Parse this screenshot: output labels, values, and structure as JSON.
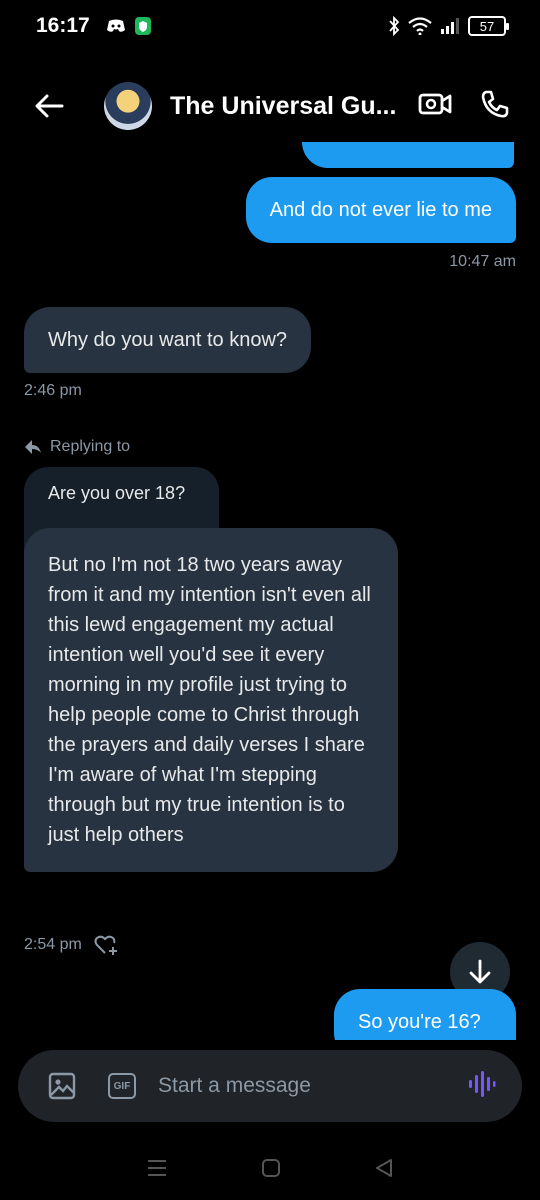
{
  "status_bar": {
    "time": "16:17",
    "battery": "57"
  },
  "header": {
    "title": "The Universal Gu..."
  },
  "messages": {
    "sent1_partial": "",
    "sent2": "And do not ever lie to me",
    "sent2_time": "10:47 am",
    "recv1": "Why do you want to know?",
    "recv1_time": "2:46 pm",
    "replying_to_label": "Replying to",
    "quoted_text": "Are you over 18?",
    "recv2": "But no I'm not 18 two years away from it and my intention isn't even all this lewd engagement my actual intention well you'd see it every morning in my profile just trying to help people come to Christ through the prayers and daily verses I share I'm aware of what I'm stepping through but my true intention is to just help others",
    "recv2_time": "2:54 pm",
    "sent3": "So you're 16?"
  },
  "composer": {
    "gif_label": "GIF",
    "placeholder": "Start a message"
  },
  "colors": {
    "sent_bubble": "#1d9bf0",
    "recv_bubble": "#273340",
    "accent_voice": "#7856ff"
  },
  "icons": [
    "back-arrow-icon",
    "video-call-icon",
    "phone-icon",
    "reply-arrow-icon",
    "add-reaction-icon",
    "arrow-down-icon",
    "image-icon",
    "gif-icon",
    "voice-icon",
    "menu-icon",
    "home-icon",
    "back-icon"
  ]
}
